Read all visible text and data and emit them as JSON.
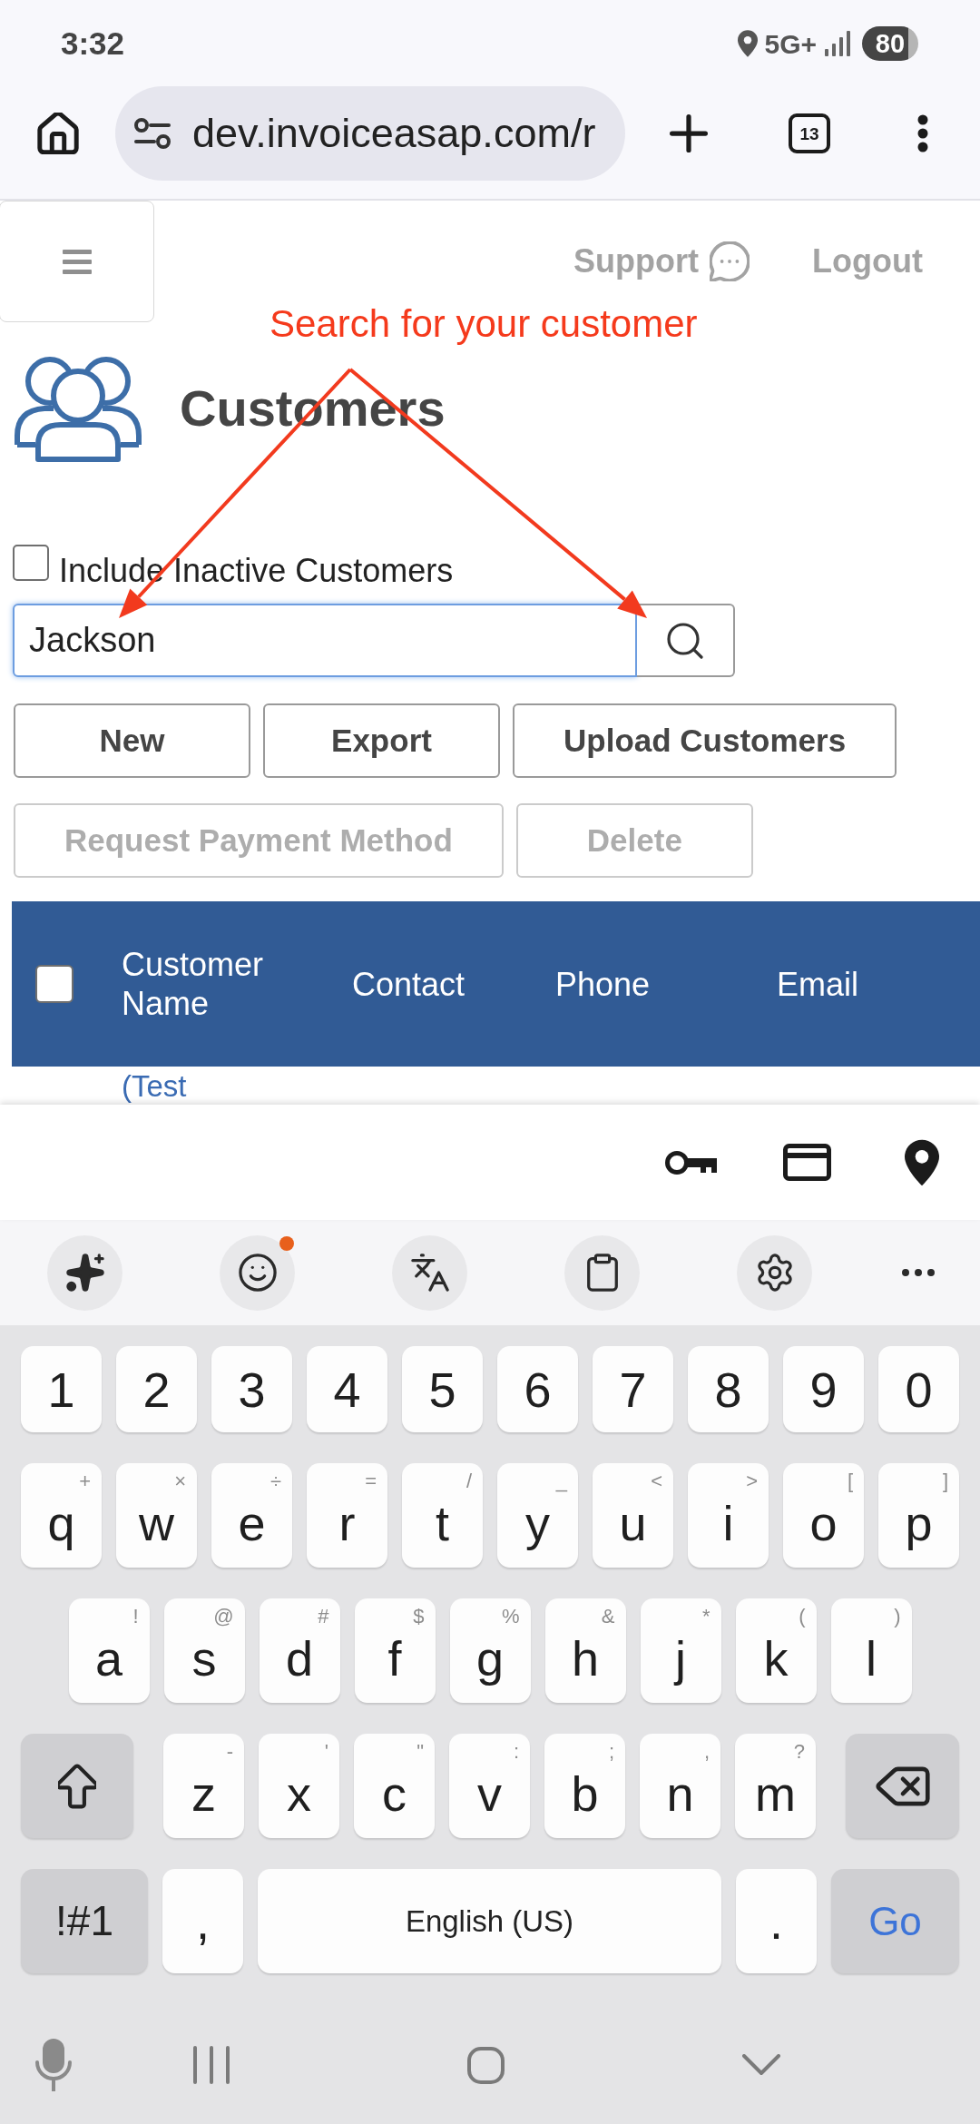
{
  "status_bar": {
    "time": "3:32",
    "network": "5G+",
    "battery": "80"
  },
  "browser": {
    "url": "dev.invoiceasap.com/r",
    "tab_count": "13"
  },
  "nav_links": [
    {
      "kind": "support",
      "label": "Support"
    },
    {
      "kind": "logout",
      "label": "Logout"
    }
  ],
  "annotation": {
    "text": "Search for your customer"
  },
  "page": {
    "title": "Customers",
    "include_inactive": {
      "label": "Include Inactive Customers",
      "checked": false
    },
    "search": {
      "value": "Jackson"
    },
    "button_rows": [
      [
        {
          "label": "New",
          "disabled": false
        },
        {
          "label": "Export",
          "disabled": false
        },
        {
          "label": "Upload Customers",
          "disabled": false
        }
      ],
      [
        {
          "label": "Request Payment Method",
          "disabled": true
        },
        {
          "label": "Delete",
          "disabled": true
        }
      ]
    ]
  },
  "table": {
    "select_all": {
      "checked": false
    },
    "columns": [
      "Customer Name",
      "Contact",
      "Phone",
      "Email"
    ],
    "rows": [
      {
        "customer_name": "(Test"
      }
    ]
  },
  "keyboard": {
    "emoji_badge": true,
    "rows": [
      {
        "kind": "numbers",
        "keys": [
          {
            "kind": "char",
            "label": "1"
          },
          {
            "kind": "char",
            "label": "2"
          },
          {
            "kind": "char",
            "label": "3"
          },
          {
            "kind": "char",
            "label": "4"
          },
          {
            "kind": "char",
            "label": "5"
          },
          {
            "kind": "char",
            "label": "6"
          },
          {
            "kind": "char",
            "label": "7"
          },
          {
            "kind": "char",
            "label": "8"
          },
          {
            "kind": "char",
            "label": "9"
          },
          {
            "kind": "char",
            "label": "0"
          }
        ]
      },
      {
        "kind": "letters",
        "keys": [
          {
            "kind": "char",
            "label": "q",
            "hint": "+"
          },
          {
            "kind": "char",
            "label": "w",
            "hint": "×"
          },
          {
            "kind": "char",
            "label": "e",
            "hint": "÷"
          },
          {
            "kind": "char",
            "label": "r",
            "hint": "="
          },
          {
            "kind": "char",
            "label": "t",
            "hint": "/"
          },
          {
            "kind": "char",
            "label": "y",
            "hint": "_"
          },
          {
            "kind": "char",
            "label": "u",
            "hint": "<"
          },
          {
            "kind": "char",
            "label": "i",
            "hint": ">"
          },
          {
            "kind": "char",
            "label": "o",
            "hint": "["
          },
          {
            "kind": "char",
            "label": "p",
            "hint": "]"
          }
        ]
      },
      {
        "kind": "letters",
        "keys": [
          {
            "kind": "char",
            "label": "a",
            "hint": "!"
          },
          {
            "kind": "char",
            "label": "s",
            "hint": "@"
          },
          {
            "kind": "char",
            "label": "d",
            "hint": "#"
          },
          {
            "kind": "char",
            "label": "f",
            "hint": "$"
          },
          {
            "kind": "char",
            "label": "g",
            "hint": "%"
          },
          {
            "kind": "char",
            "label": "h",
            "hint": "&"
          },
          {
            "kind": "char",
            "label": "j",
            "hint": "*"
          },
          {
            "kind": "char",
            "label": "k",
            "hint": "("
          },
          {
            "kind": "char",
            "label": "l",
            "hint": ")"
          }
        ]
      },
      {
        "kind": "letters",
        "keys": [
          {
            "kind": "shift"
          },
          {
            "kind": "char",
            "label": "z",
            "hint": "-"
          },
          {
            "kind": "char",
            "label": "x",
            "hint": "'"
          },
          {
            "kind": "char",
            "label": "c",
            "hint": "\""
          },
          {
            "kind": "char",
            "label": "v",
            "hint": ":"
          },
          {
            "kind": "char",
            "label": "b",
            "hint": ";"
          },
          {
            "kind": "char",
            "label": "n",
            "hint": ","
          },
          {
            "kind": "char",
            "label": "m",
            "hint": "?"
          },
          {
            "kind": "backspace"
          }
        ]
      },
      {
        "kind": "bottom",
        "keys": [
          {
            "kind": "symbols",
            "label": "!#1"
          },
          {
            "kind": "char",
            "label": ","
          },
          {
            "kind": "space",
            "label": "English (US)"
          },
          {
            "kind": "char",
            "label": "."
          },
          {
            "kind": "action",
            "label": "Go"
          }
        ]
      }
    ]
  }
}
